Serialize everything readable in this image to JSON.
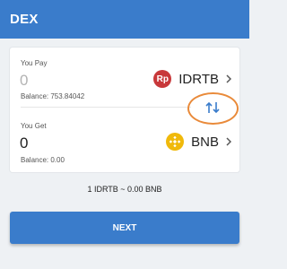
{
  "header": {
    "title": "DEX"
  },
  "pay": {
    "label": "You Pay",
    "amount": "0",
    "balance": "Balance: 753.84042",
    "token": {
      "symbol": "IDRTB",
      "icon": "rupiah-token-icon",
      "icon_text": "Rp",
      "color": "#c8383a"
    }
  },
  "get": {
    "label": "You Get",
    "amount": "0",
    "balance": "Balance: 0.00",
    "token": {
      "symbol": "BNB",
      "icon": "bnb-token-icon",
      "color": "#f0b90b"
    }
  },
  "swap": {
    "icon": "swap-arrows-icon",
    "highlight_color": "#e98a3a"
  },
  "rate": "1 IDRTB ~ 0.00 BNB",
  "next_button": {
    "label": "NEXT"
  },
  "colors": {
    "primary": "#3a7ccb",
    "background": "#eef1f4"
  }
}
